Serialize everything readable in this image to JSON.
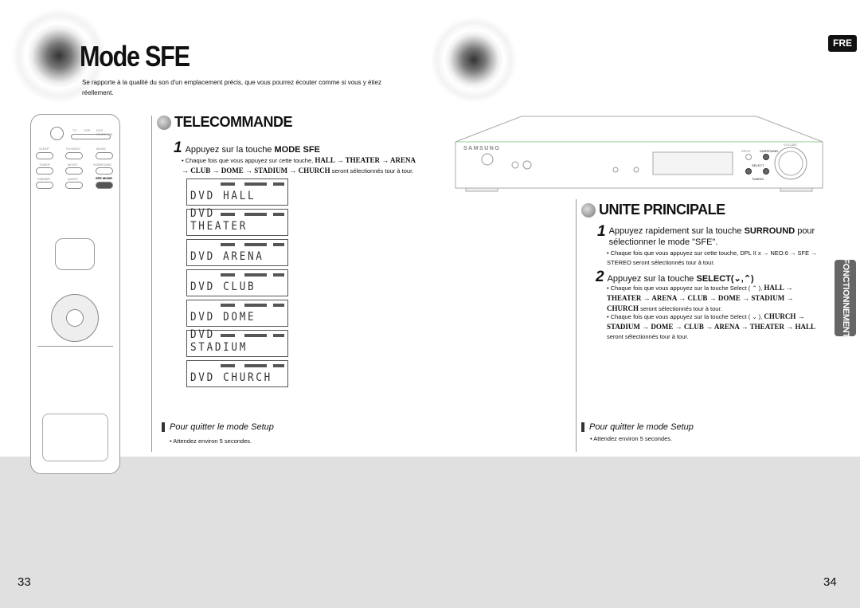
{
  "header": {
    "title": "Mode SFE",
    "subtitle": "Se rapporte à la qualité du son d'un emplacement précis, que vous pourrez écouter comme si vous y étiez réellement.",
    "language_badge": "FRE"
  },
  "remote": {
    "labels": [
      "TV",
      "VCR",
      "DVD RECEIVER",
      "SLEEP",
      "TV/VIDEO",
      "MODE",
      "TUNER",
      "MO/ST",
      "SURROUND",
      "DIMMER",
      "AUDIO",
      "SFE MODE"
    ]
  },
  "telecommande": {
    "heading": "TELECOMMANDE",
    "step1": {
      "number": "1",
      "text": "Appuyez sur la touche ",
      "key": "MODE SFE"
    },
    "bullet_pre": "• Chaque fois que vous appuyez sur cette touche, ",
    "bullet_seq": "HALL → THEATER → ARENA → CLUB → DOME → STADIUM → CHURCH",
    "bullet_post": " seront sélectionnés tour à tour.",
    "displays": [
      "DVD HALL",
      "DVD THEATER",
      "DVD ARENA",
      "DVD CLUB",
      "DVD DOME",
      "DVD STADIUM",
      "DVD CHURCH"
    ],
    "quit_title": "Pour quitter le mode Setup",
    "quit_text": "• Attendez environ 5 secondes."
  },
  "device": {
    "brand": "SAMSUNG",
    "labels": {
      "input": "INPUT",
      "surround": "SURROUND",
      "select": "SELECT",
      "volume": "VOLUME",
      "tuning": "TUNING"
    }
  },
  "unite": {
    "heading": "UNITE PRINCIPALE",
    "step1": {
      "number": "1",
      "text": "Appuyez rapidement sur la touche ",
      "key": "SURROUND",
      "text2": " pour sélectionner le mode \"SFE\".",
      "bullet": "• Chaque fois que vous appuyez sur cette touche, DPL II x → NEO:6 → SFE → STEREO seront sélectionnés tour à tour."
    },
    "step2": {
      "number": "2",
      "text": "Appuyez sur la touche ",
      "key": "SELECT(⌄,⌃)",
      "bullet1_pre": "• Chaque fois que vous appuyez sur la touche Select ( ⌃ ), ",
      "bullet1_seq": "HALL → THEATER → ARENA → CLUB → DOME → STADIUM → CHURCH",
      "bullet1_post": " seront sélectionnés tour à tour.",
      "bullet2_pre": "• Chaque fois que vous appuyez sur la touche Select ( ⌄ ), ",
      "bullet2_seq": "CHURCH → STADIUM → DOME → CLUB → ARENA → THEATER → HALL",
      "bullet2_post": " seront sélectionnés tour à tour."
    },
    "quit_title": "Pour quitter le mode Setup",
    "quit_text": "• Attendez environ 5 secondes."
  },
  "side_tab": "FONCTIONNEMENT",
  "page_numbers": {
    "left": "33",
    "right": "34"
  }
}
